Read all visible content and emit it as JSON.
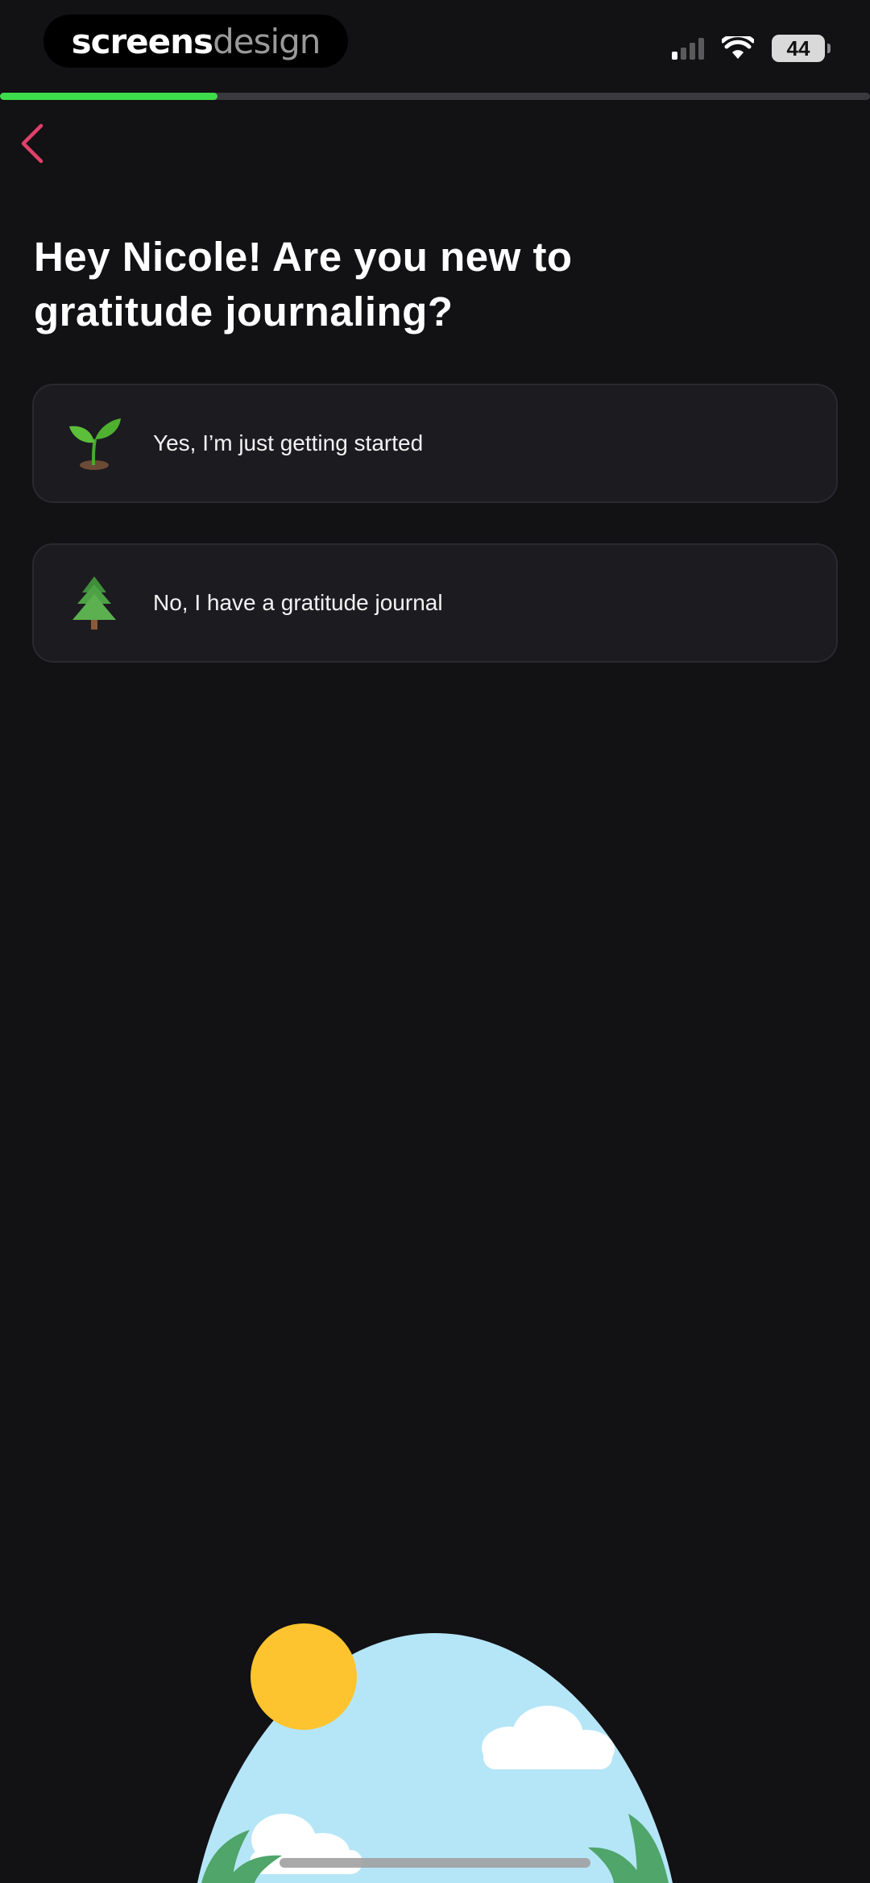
{
  "watermark": {
    "part1": "screens",
    "part2": "design"
  },
  "status_bar": {
    "battery": "44"
  },
  "progress": {
    "fraction": 0.25,
    "color": "#3ddc4a"
  },
  "header": {
    "back_icon": "chevron-left-icon",
    "back_color": "#e0406a"
  },
  "question": {
    "title": "Hey Nicole! Are you new to gratitude journaling?"
  },
  "options": [
    {
      "icon": "seedling-icon",
      "label": "Yes, I’m just getting started"
    },
    {
      "icon": "evergreen-tree-icon",
      "label": "No, I have a gratitude journal"
    }
  ],
  "colors": {
    "background": "#121114",
    "card": "#1c1b20",
    "card_border": "#2a292e"
  }
}
